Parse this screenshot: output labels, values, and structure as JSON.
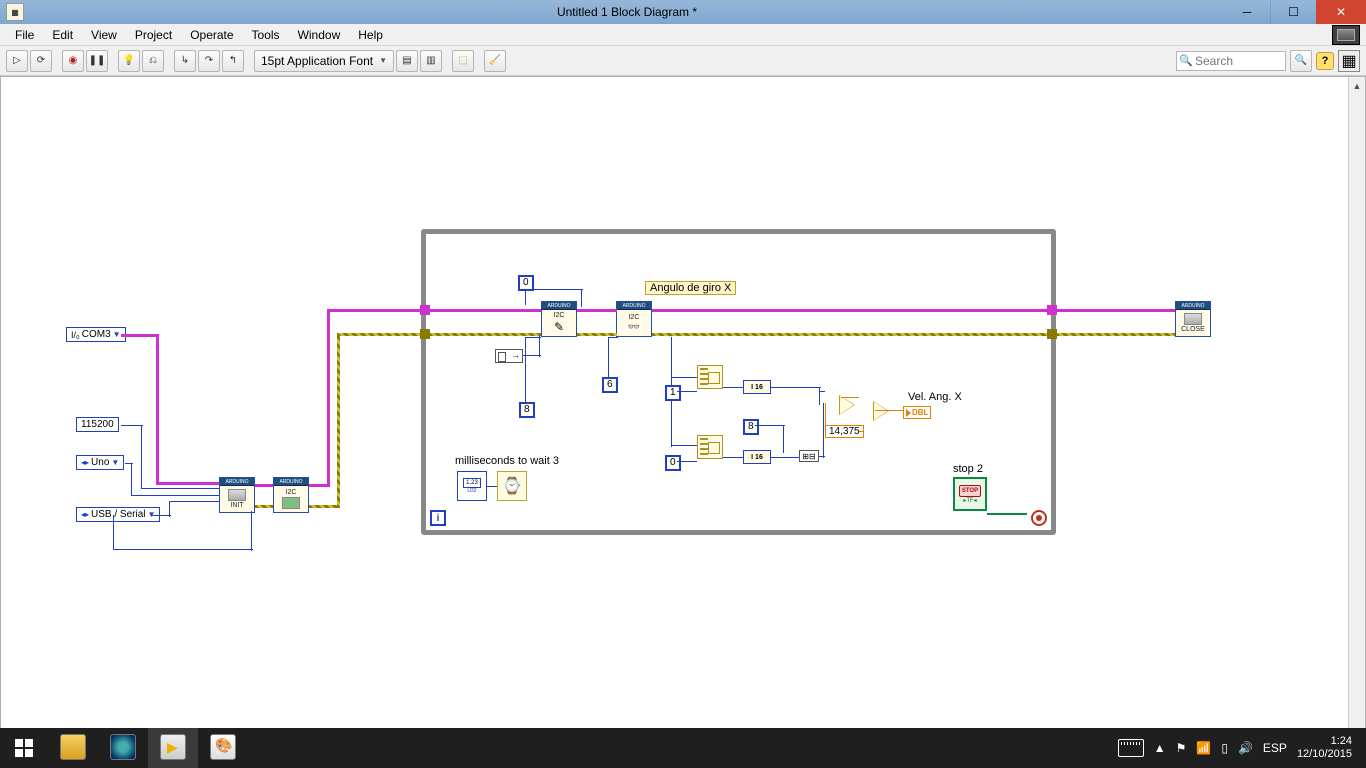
{
  "window": {
    "title": "Untitled 1 Block Diagram *"
  },
  "menu": {
    "items": [
      "File",
      "Edit",
      "View",
      "Project",
      "Operate",
      "Tools",
      "Window",
      "Help"
    ]
  },
  "toolbar": {
    "font_label": "15pt Application Font",
    "search_placeholder": "Search"
  },
  "diagram": {
    "controls": {
      "com_port": "COM3",
      "baud_rate": "115200",
      "board": "Uno",
      "connection": "USB / Serial"
    },
    "constants": {
      "addr1": "0",
      "addr2": "8",
      "addr3": "6",
      "idxA": "1",
      "idxB": "0",
      "len": "8",
      "scale": "14,375"
    },
    "labels": {
      "angle": "Angulo de giro X",
      "wait": "milliseconds to wait 3",
      "stop": "stop 2",
      "velx": "Vel. Ang. X"
    },
    "nodes": {
      "arduino_tag": "ARDUINO",
      "i2c": "I2C",
      "init": "INIT",
      "close": "CLOSE",
      "i16": "I 16",
      "u32": "1.23",
      "u32t": "U32",
      "stopbtn": "STOP",
      "dbl": "DBL",
      "tf": "▸TF◂"
    },
    "ops": {
      "div": "÷",
      "amp_tri": "▷"
    }
  },
  "taskbar": {
    "lang": "ESP",
    "time": "1:24",
    "date": "12/10/2015"
  }
}
